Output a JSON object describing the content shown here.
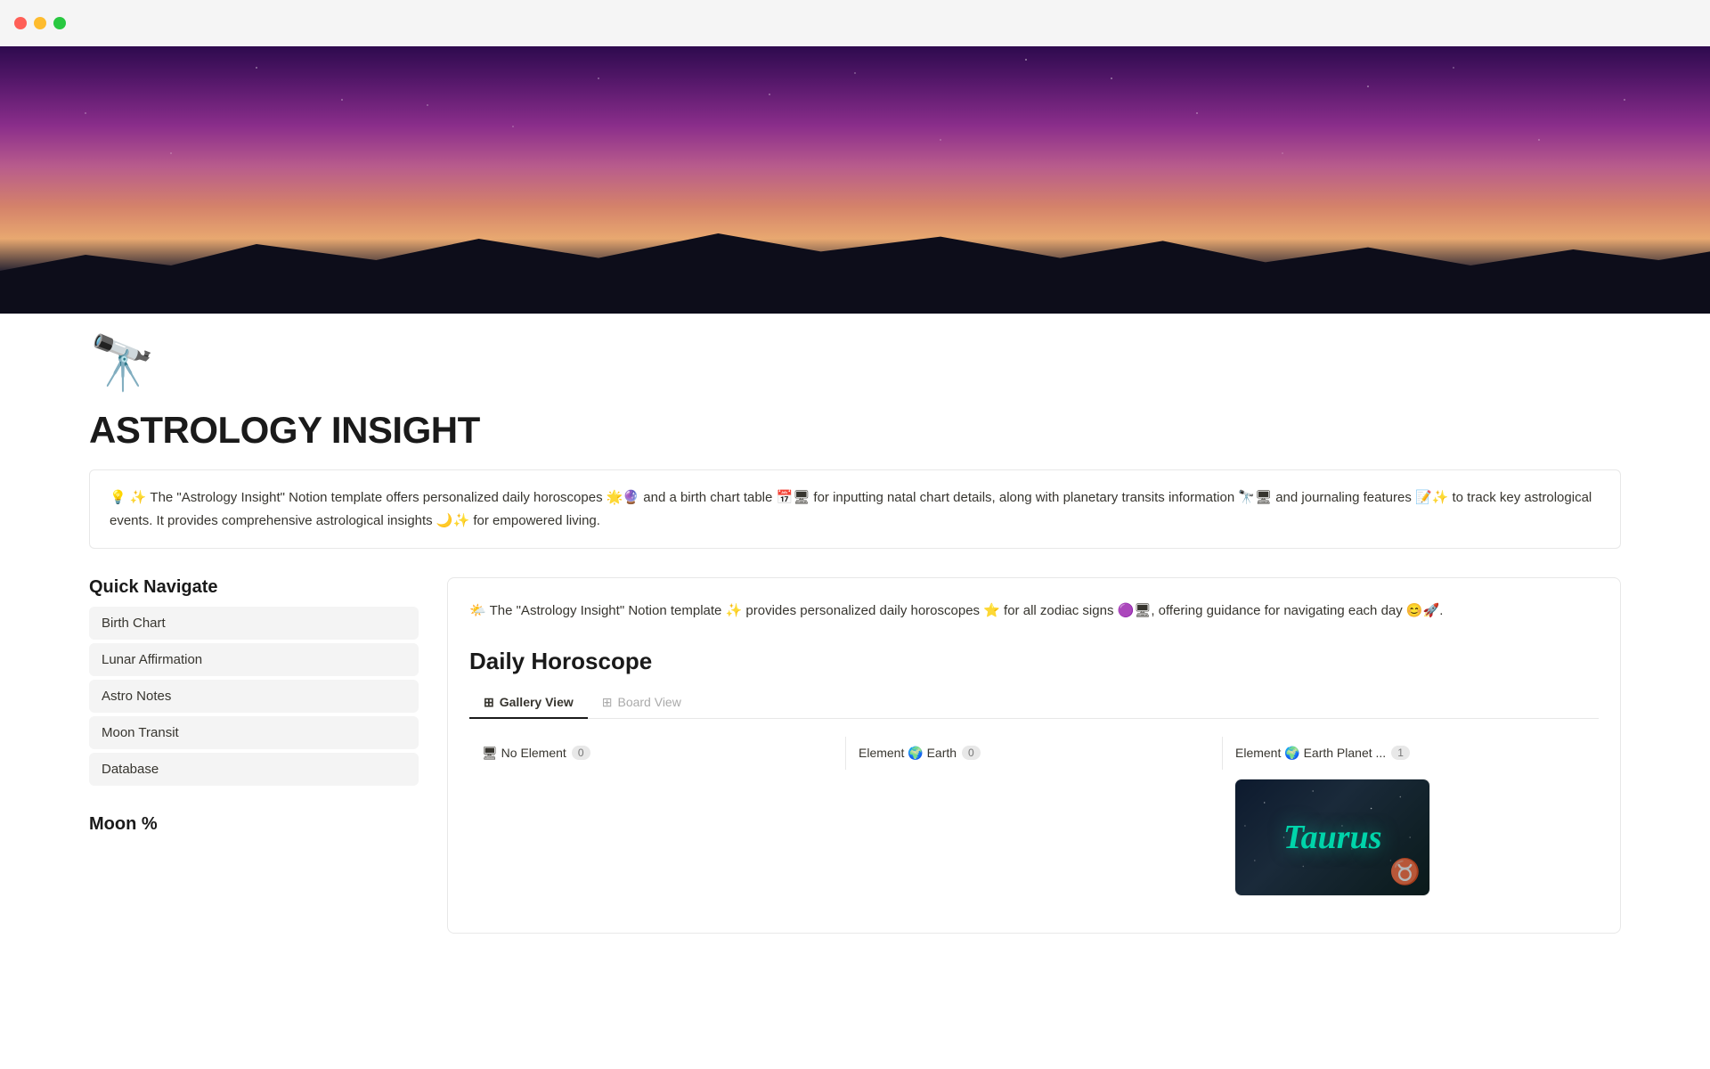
{
  "titlebar": {
    "btn_red": "close",
    "btn_yellow": "minimize",
    "btn_green": "maximize"
  },
  "page": {
    "icon": "🔭",
    "title": "ASTROLOGY INSIGHT",
    "description": "💡 ✨ The \"Astrology Insight\" Notion template offers personalized daily horoscopes 🌟🔮 and a birth chart table 📅🖥 for inputting natal chart details, along with planetary transits information 🔭🖥 and journaling features 📝✨ to track key astrological events. It provides comprehensive astrological insights 🌙✨ for empowered living.",
    "intro_emoji": "🌤️",
    "intro_text": "The \"Astrology Insight\" Notion template ✨ provides personalized daily horoscopes ⭐ for all zodiac signs 🟣🖥, offering guidance for navigating each day 😊🚀.",
    "horoscope_title": "Daily Horoscope"
  },
  "quick_navigate": {
    "title": "Quick Navigate",
    "items": [
      {
        "label": "Birth Chart"
      },
      {
        "label": "Lunar Affirmation"
      },
      {
        "label": "Astro Notes"
      },
      {
        "label": "Moon Transit"
      },
      {
        "label": "Database"
      }
    ]
  },
  "moon_section": {
    "title": "Moon %"
  },
  "tabs": [
    {
      "label": "Gallery View",
      "icon": "⊞",
      "active": true
    },
    {
      "label": "Board View",
      "icon": "⊞",
      "active": false
    }
  ],
  "columns": [
    {
      "label": "🖥 No Element",
      "count": "0"
    },
    {
      "label": "Element 🌍 Earth",
      "count": "0"
    },
    {
      "label": "Element 🌍 Earth Planet ...",
      "count": "1"
    }
  ],
  "taurus_card": {
    "text": "Taurus",
    "bull_icon": "♉"
  }
}
